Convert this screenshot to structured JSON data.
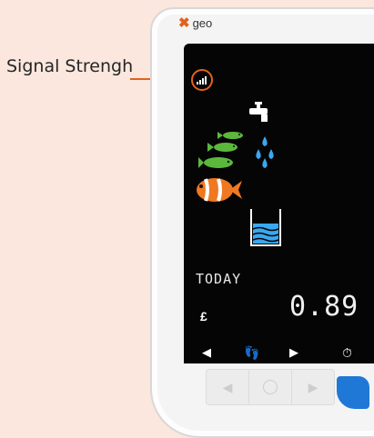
{
  "callout": {
    "label": "Signal Strengh",
    "color": "#e2621c"
  },
  "device": {
    "brand": "geo",
    "brand_mark": "x-logo"
  },
  "display": {
    "today_label": "TODAY",
    "currency": "£",
    "amount": "0.89",
    "icons": [
      "signal-icon",
      "tap-icon",
      "water-drops-icon",
      "fish-icon",
      "clownfish-icon",
      "water-glass-icon"
    ]
  },
  "controls": {
    "nav": [
      "left-arrow-icon",
      "footprint-icon",
      "right-arrow-icon",
      "timer-icon"
    ],
    "bottom_buttons": [
      "left-button",
      "center-button",
      "right-button"
    ],
    "accent": "#1f78d6"
  }
}
